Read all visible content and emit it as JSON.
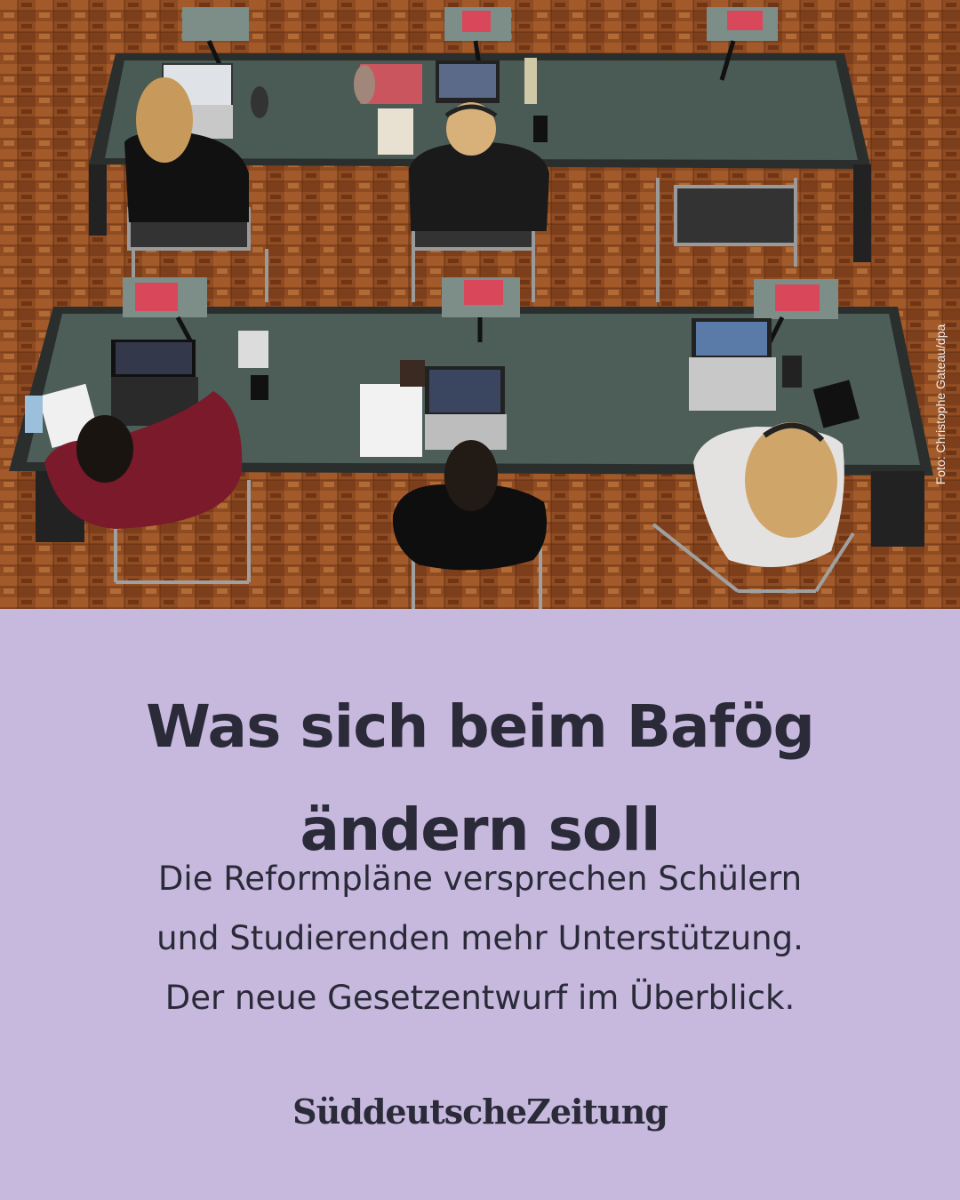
{
  "photo": {
    "credit": "Foto: Christophe Gateau/dpa",
    "description_icon": "photo-library-icon"
  },
  "headline": {
    "line1": "Was sich beim Bafög",
    "line2": "ändern soll"
  },
  "subline": {
    "line1": "Die Reformpläne versprechen Schülern",
    "line2": "und Studierenden mehr Unterstützung.",
    "line3": "Der neue Gesetzentwurf im Überblick."
  },
  "brand": {
    "logo_text": "SüddeutscheZeitung"
  },
  "colors": {
    "panel_bg": "#c7b9de",
    "text": "#2a2a38",
    "floor": "#8a4a22",
    "desk": "#4a5a55"
  }
}
